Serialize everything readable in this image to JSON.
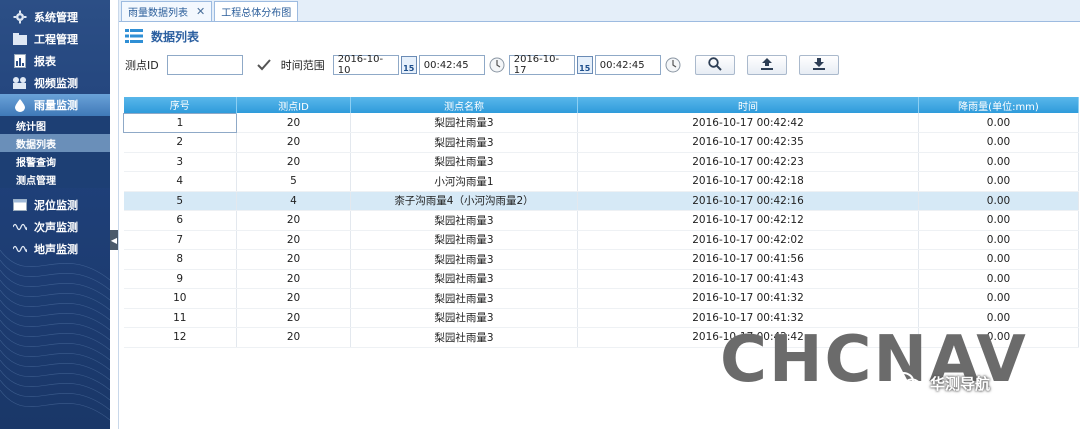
{
  "sidebar": {
    "items": [
      {
        "label": "系统管理",
        "icon": "gear-icon"
      },
      {
        "label": "工程管理",
        "icon": "folder-icon"
      },
      {
        "label": "报表",
        "icon": "report-icon"
      },
      {
        "label": "视频监测",
        "icon": "camera-icon"
      },
      {
        "label": "雨量监测",
        "icon": "raindrop-icon"
      },
      {
        "label": "泥位监测",
        "icon": "gauge-icon"
      },
      {
        "label": "次声监测",
        "icon": "wave-icon"
      },
      {
        "label": "地声监测",
        "icon": "wave-icon"
      }
    ],
    "subitems": [
      {
        "label": "统计图"
      },
      {
        "label": "数据列表"
      },
      {
        "label": "报警查询"
      },
      {
        "label": "测点管理"
      }
    ]
  },
  "tabs": [
    {
      "label": "雨量数据列表"
    },
    {
      "label": "工程总体分布图"
    }
  ],
  "page": {
    "title": "数据列表"
  },
  "filters": {
    "point_id_label": "测点ID",
    "point_id_value": "",
    "range_label": "时间范围",
    "start_date": "2016-10-10",
    "start_time": "00:42:45",
    "end_date": "2016-10-17",
    "end_time": "00:42:45",
    "cal_label": "15"
  },
  "table": {
    "columns": [
      "序号",
      "测点ID",
      "测点名称",
      "时间",
      "降雨量(单位:mm)"
    ],
    "rows": [
      [
        "1",
        "20",
        "梨园社雨量3",
        "2016-10-17 00:42:42",
        "0.00"
      ],
      [
        "2",
        "20",
        "梨园社雨量3",
        "2016-10-17 00:42:35",
        "0.00"
      ],
      [
        "3",
        "20",
        "梨园社雨量3",
        "2016-10-17 00:42:23",
        "0.00"
      ],
      [
        "4",
        "5",
        "小河沟雨量1",
        "2016-10-17 00:42:18",
        "0.00"
      ],
      [
        "5",
        "4",
        "柰子沟雨量4（小河沟雨量2）",
        "2016-10-17 00:42:16",
        "0.00"
      ],
      [
        "6",
        "20",
        "梨园社雨量3",
        "2016-10-17 00:42:12",
        "0.00"
      ],
      [
        "7",
        "20",
        "梨园社雨量3",
        "2016-10-17 00:42:02",
        "0.00"
      ],
      [
        "8",
        "20",
        "梨园社雨量3",
        "2016-10-17 00:41:56",
        "0.00"
      ],
      [
        "9",
        "20",
        "梨园社雨量3",
        "2016-10-17 00:41:43",
        "0.00"
      ],
      [
        "10",
        "20",
        "梨园社雨量3",
        "2016-10-17 00:41:32",
        "0.00"
      ],
      [
        "11",
        "20",
        "梨园社雨量3",
        "2016-10-17 00:41:32",
        "0.00"
      ],
      [
        "12",
        "20",
        "梨园社雨量3",
        "2016-10-17 00:42:42",
        "0.00"
      ]
    ]
  },
  "watermark": {
    "logo": "CHCNAV",
    "account": "华测导航"
  }
}
